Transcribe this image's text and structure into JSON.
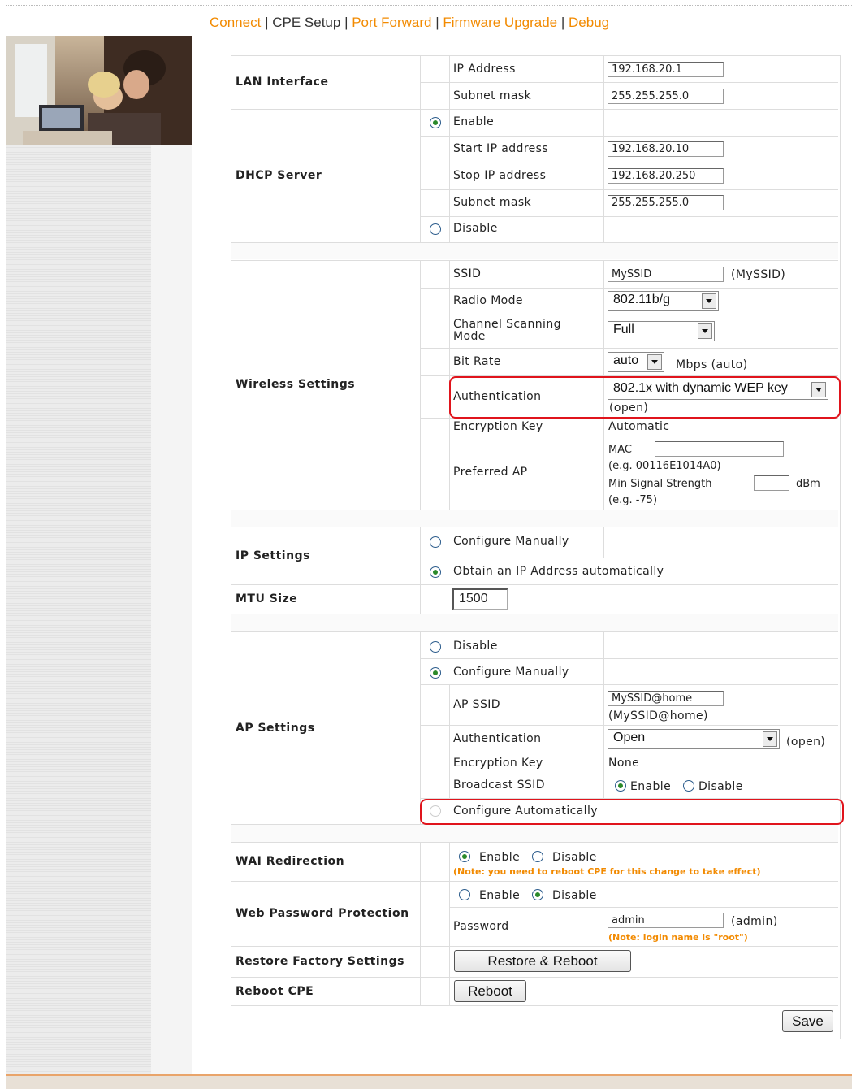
{
  "nav": {
    "connect": "Connect",
    "cpe_setup": "CPE Setup",
    "port_forward": "Port Forward",
    "firmware_upgrade": "Firmware Upgrade",
    "debug": "Debug",
    "separator": "|"
  },
  "lan": {
    "title": "LAN Interface",
    "ip_label": "IP Address",
    "ip_value": "192.168.20.1",
    "mask_label": "Subnet mask",
    "mask_value": "255.255.255.0"
  },
  "dhcp": {
    "title": "DHCP Server",
    "enable_label": "Enable",
    "start_label": "Start IP address",
    "start_value": "192.168.20.10",
    "stop_label": "Stop IP address",
    "stop_value": "192.168.20.250",
    "mask_label": "Subnet mask",
    "mask_value": "255.255.255.0",
    "disable_label": "Disable",
    "selected": "Enable"
  },
  "wireless": {
    "title": "Wireless Settings",
    "ssid_label": "SSID",
    "ssid_value": "MySSID",
    "ssid_hint": "(MySSID)",
    "radio_label": "Radio Mode",
    "radio_value": "802.11b/g",
    "scan_label": "Channel Scanning Mode",
    "scan_value": "Full",
    "bitrate_label": "Bit Rate",
    "bitrate_value": "auto",
    "bitrate_hint": "Mbps (auto)",
    "auth_label": "Authentication",
    "auth_value": "802.1x with dynamic WEP key",
    "auth_hint": "(open)",
    "enc_label": "Encryption Key",
    "enc_value": "Automatic",
    "pref_label": "Preferred AP",
    "mac_label": "MAC",
    "mac_value": "",
    "mac_hint": "(e.g. 00116E1014A0)",
    "minsig_label": "Min Signal Strength",
    "minsig_value": "",
    "minsig_unit": "dBm",
    "minsig_hint": "(e.g. -75)"
  },
  "ip_settings": {
    "title": "IP Settings",
    "manual_label": "Configure Manually",
    "auto_label": "Obtain an IP Address automatically",
    "selected": "Obtain an IP Address automatically"
  },
  "mtu": {
    "title": "MTU Size",
    "value": "1500"
  },
  "ap": {
    "title": "AP Settings",
    "disable_label": "Disable",
    "manual_label": "Configure Manually",
    "ssid_label": "AP SSID",
    "ssid_value": "MySSID@home",
    "ssid_hint": "(MySSID@home)",
    "auth_label": "Authentication",
    "auth_value": "Open",
    "auth_hint": "(open)",
    "enc_label": "Encryption Key",
    "enc_value": "None",
    "bcast_label": "Broadcast SSID",
    "bcast_enable": "Enable",
    "bcast_disable": "Disable",
    "bcast_selected": "Enable",
    "auto_label": "Configure Automatically",
    "selected": "Configure Manually"
  },
  "wai": {
    "title": "WAI Redirection",
    "enable": "Enable",
    "disable": "Disable",
    "selected": "Enable",
    "note": "(Note: you need to reboot CPE for this change to take effect)"
  },
  "webpw": {
    "title": "Web Password Protection",
    "enable": "Enable",
    "disable": "Disable",
    "selected": "Disable",
    "pw_label": "Password",
    "pw_value": "admin",
    "pw_hint": "(admin)",
    "note": "(Note: login name is \"root\")"
  },
  "restore": {
    "title": "Restore Factory Settings",
    "button": "Restore & Reboot"
  },
  "reboot": {
    "title": "Reboot CPE",
    "button": "Reboot"
  },
  "save_button": "Save",
  "colors": {
    "link": "#f28a00",
    "highlight": "#e0141c",
    "radio_dot": "#2a8a2a"
  }
}
